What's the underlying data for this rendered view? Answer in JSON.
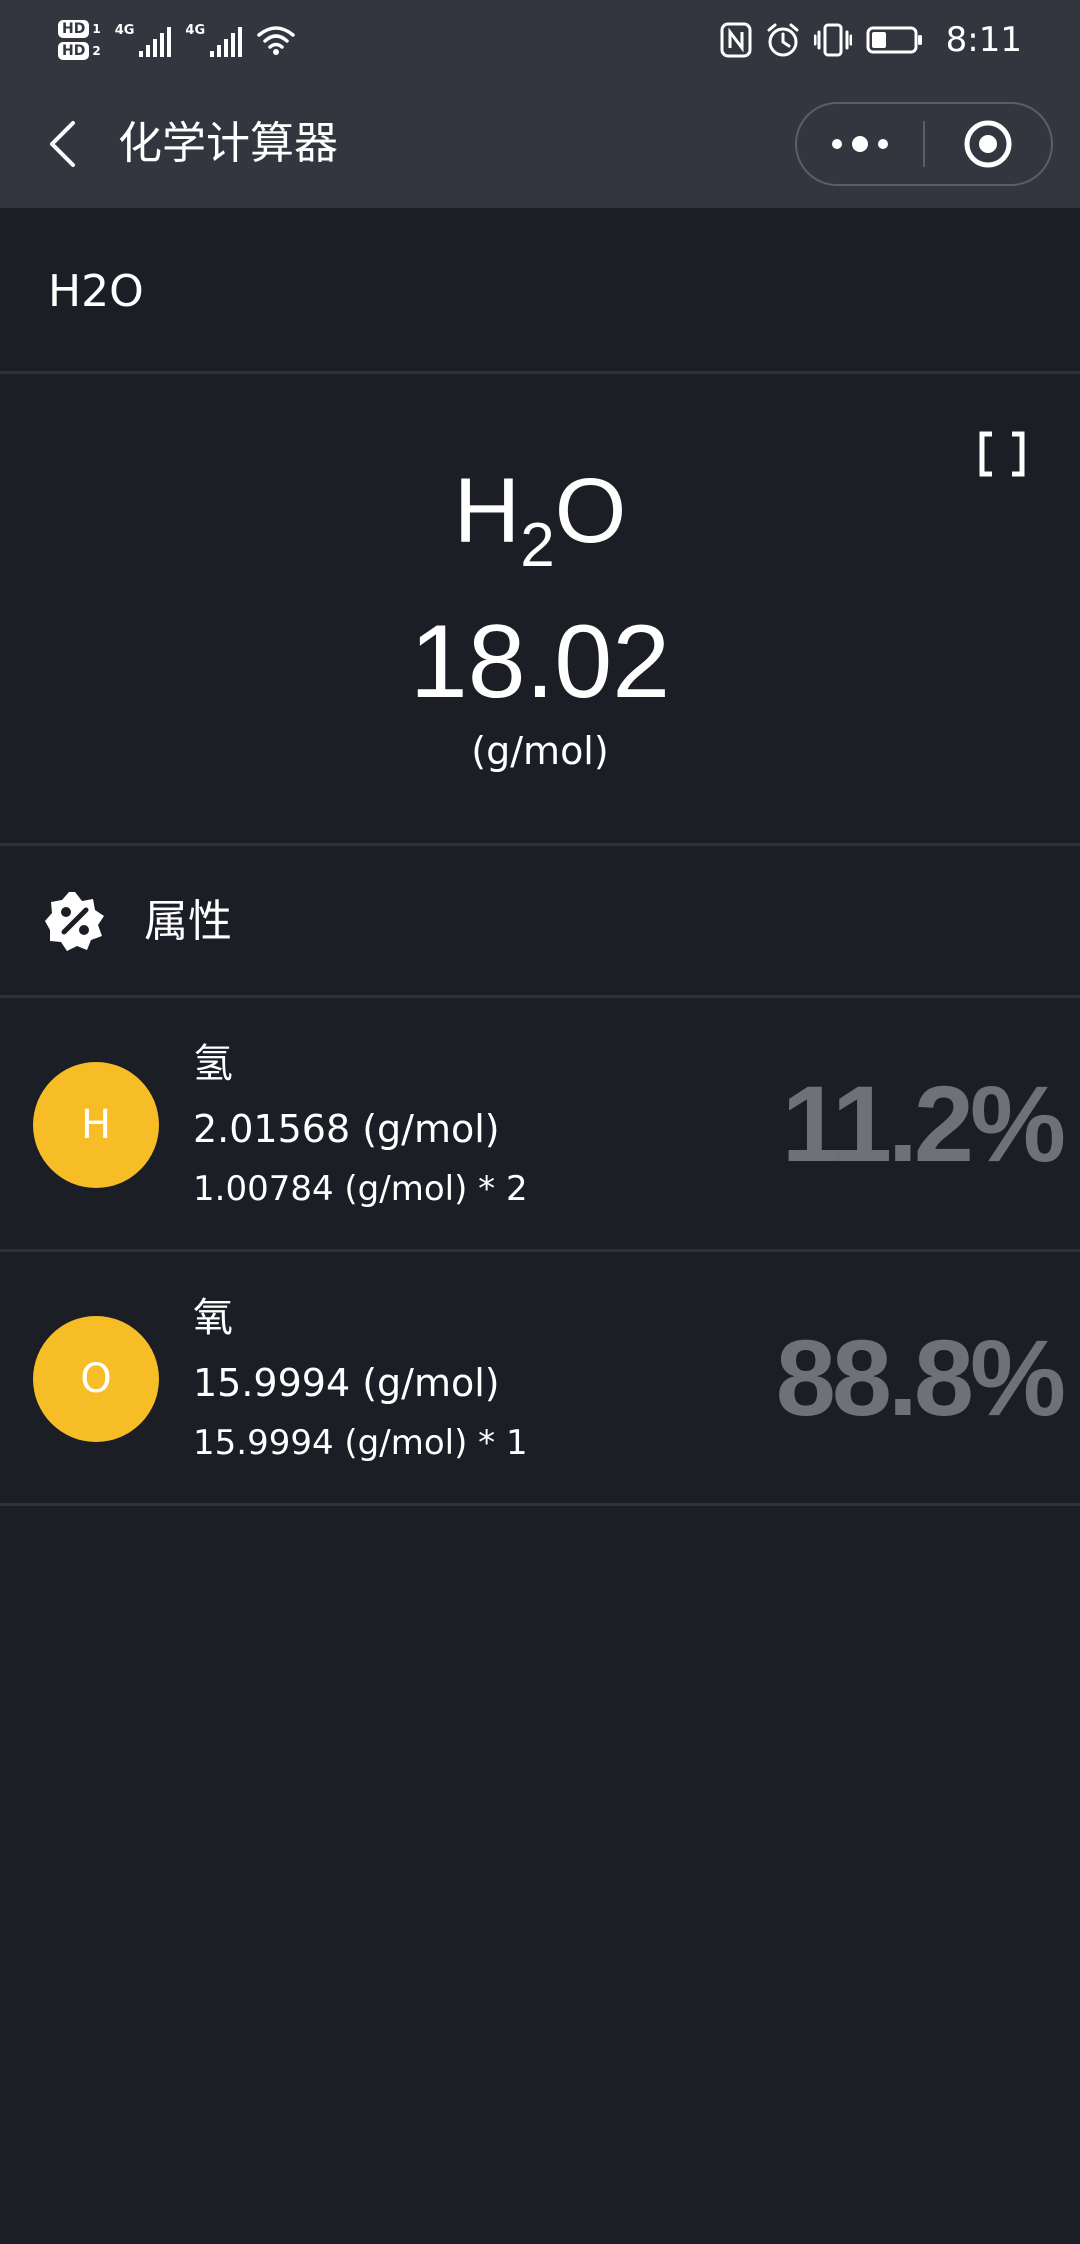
{
  "status_bar": {
    "hd1": "HD",
    "hd1_sub": "1",
    "hd2": "HD",
    "hd2_sub": "2",
    "sim1_network": "4G",
    "sim2_network": "4G",
    "time": "8:11",
    "battery_level": 0.35,
    "icons": [
      "signal-icon",
      "wifi-icon",
      "nfc-icon",
      "alarm-icon",
      "vibrate-icon",
      "battery-icon"
    ]
  },
  "nav": {
    "title": "化学计算器",
    "icons": [
      "back-arrow-icon",
      "more-dots-icon",
      "target-icon"
    ]
  },
  "formula_input": {
    "value": "H2O"
  },
  "result": {
    "symbol_1": "H",
    "subscript_1": "2",
    "symbol_2": "O",
    "molar_mass": "18.02",
    "unit": "(g/mol)"
  },
  "properties": {
    "label": "属性",
    "icon": "gear-percent-icon"
  },
  "elements": [
    {
      "symbol": "H",
      "name": "氢",
      "mass": "2.01568 (g/mol)",
      "detail": "1.00784 (g/mol) * 2",
      "percent": "11.2%"
    },
    {
      "symbol": "O",
      "name": "氧",
      "mass": "15.9994 (g/mol)",
      "detail": "15.9994 (g/mol) * 1",
      "percent": "88.8%"
    }
  ],
  "colors": {
    "background": "#1c1e25",
    "header": "#33363e",
    "element_badge": "#f6bd27",
    "percent_text": "#6f7178",
    "divider": "#2f323a"
  }
}
